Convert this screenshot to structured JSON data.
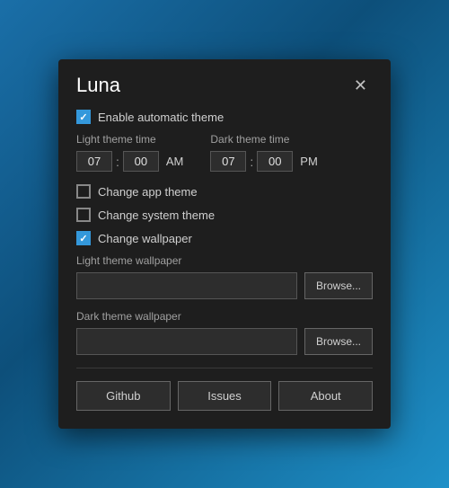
{
  "dialog": {
    "title": "Luna",
    "close_label": "✕"
  },
  "auto_theme": {
    "label": "Enable automatic theme",
    "checked": true
  },
  "light_theme_time": {
    "label": "Light theme time",
    "hour": "07",
    "minute": "00",
    "ampm": "AM"
  },
  "dark_theme_time": {
    "label": "Dark theme time",
    "hour": "07",
    "minute": "00",
    "ampm": "PM"
  },
  "change_app_theme": {
    "label": "Change app theme",
    "checked": false
  },
  "change_system_theme": {
    "label": "Change system theme",
    "checked": false
  },
  "change_wallpaper": {
    "label": "Change wallpaper",
    "checked": true
  },
  "light_wallpaper": {
    "label": "Light theme wallpaper",
    "placeholder": "",
    "browse_label": "Browse..."
  },
  "dark_wallpaper": {
    "label": "Dark theme wallpaper",
    "placeholder": "",
    "browse_label": "Browse..."
  },
  "footer": {
    "github_label": "Github",
    "issues_label": "Issues",
    "about_label": "About"
  }
}
